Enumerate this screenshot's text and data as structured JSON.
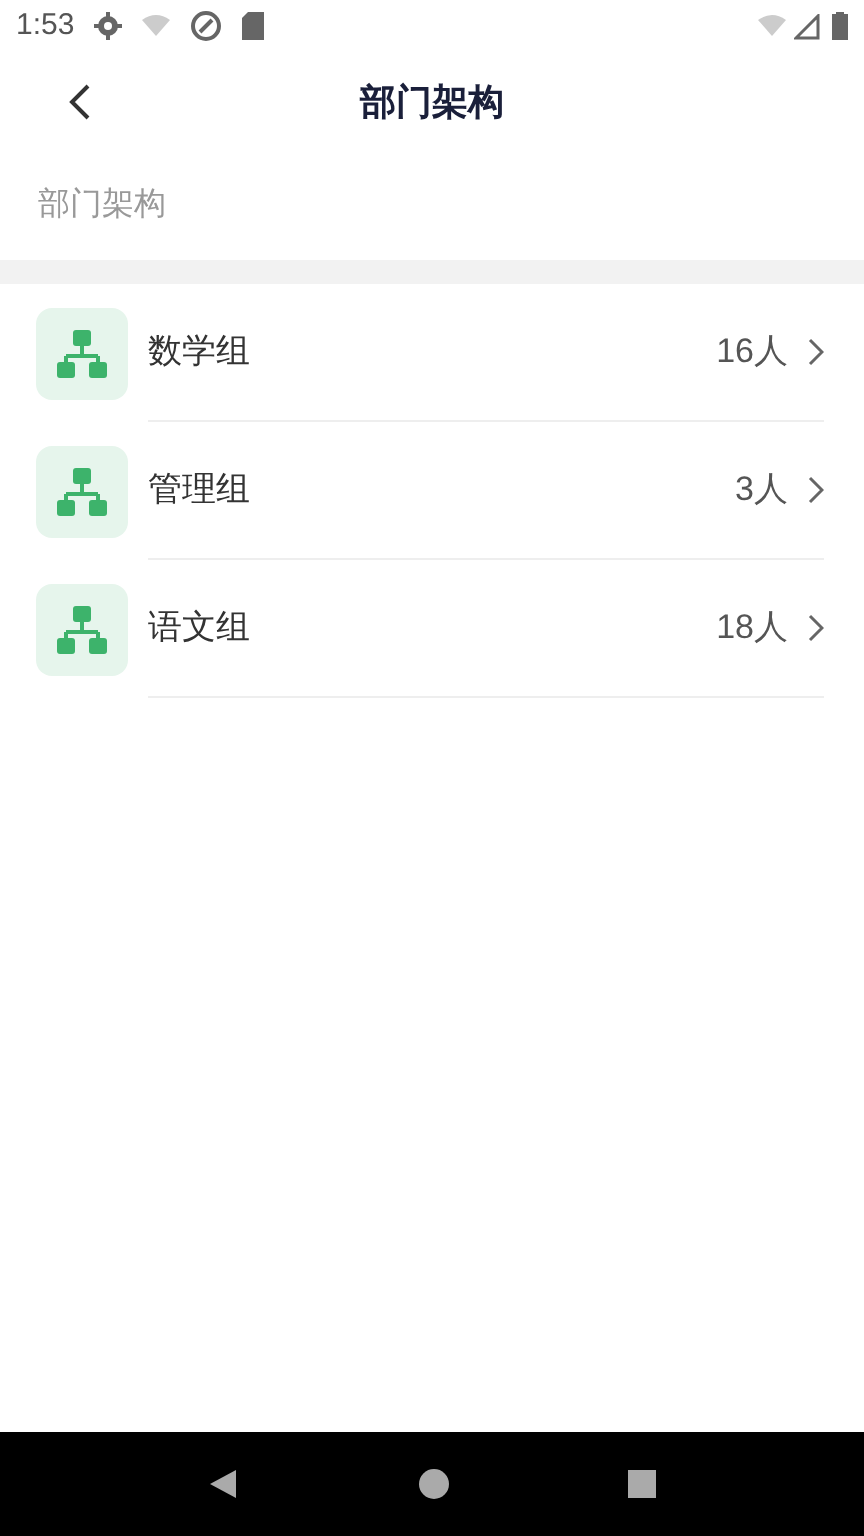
{
  "status_bar": {
    "time": "1:53"
  },
  "header": {
    "title": "部门架构"
  },
  "breadcrumb": "部门架构",
  "departments": [
    {
      "name": "数学组",
      "count": "16人"
    },
    {
      "name": "管理组",
      "count": "3人"
    },
    {
      "name": "语文组",
      "count": "18人"
    }
  ]
}
